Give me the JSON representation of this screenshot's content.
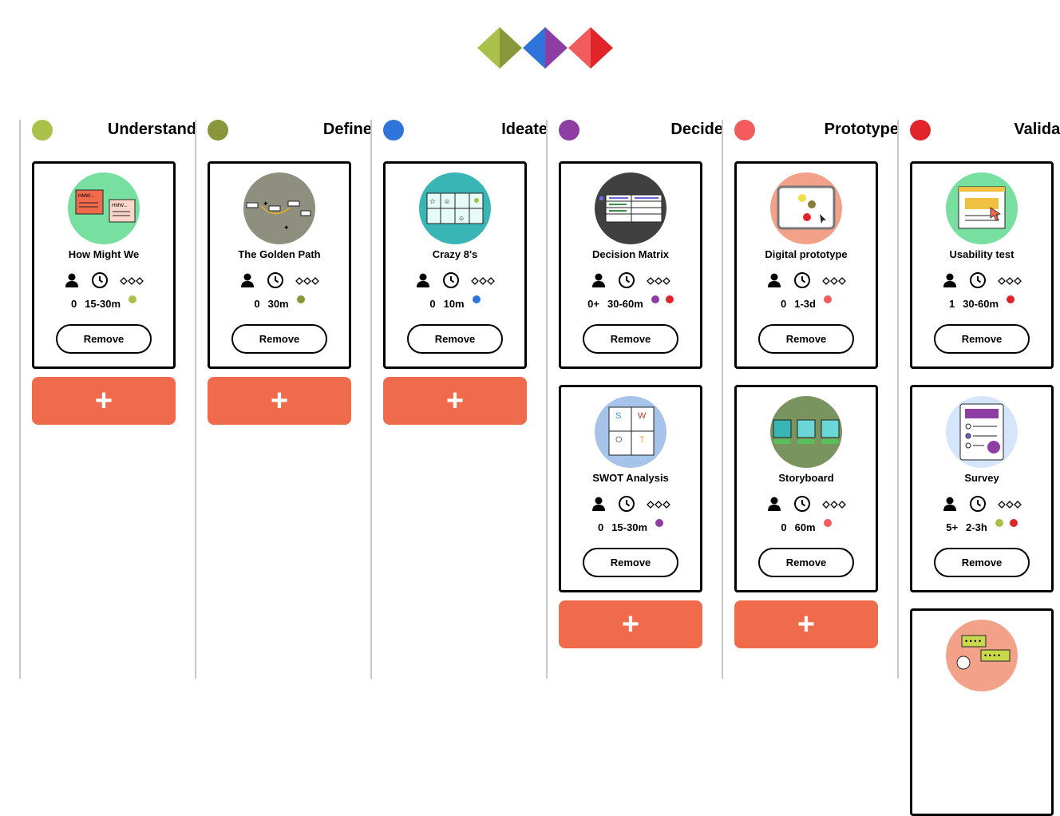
{
  "logo": {
    "name": "double-diamond-logo"
  },
  "columns": [
    {
      "title": "Understand",
      "color": "#a9c04a",
      "cards": [
        {
          "name": "How Might We",
          "people": "0",
          "time": "15-30m",
          "dots": [
            "#a9c04a"
          ],
          "remove": "Remove"
        }
      ],
      "add_label": "+"
    },
    {
      "title": "Define",
      "color": "#8a963a",
      "cards": [
        {
          "name": "The Golden Path",
          "people": "0",
          "time": "30m",
          "dots": [
            "#8a963a"
          ],
          "remove": "Remove"
        }
      ],
      "add_label": "+"
    },
    {
      "title": "Ideate",
      "color": "#2f74db",
      "cards": [
        {
          "name": "Crazy 8's",
          "people": "0",
          "time": "10m",
          "dots": [
            "#2f74db"
          ],
          "remove": "Remove"
        }
      ],
      "add_label": "+"
    },
    {
      "title": "Decide",
      "color": "#8e3ea2",
      "cards": [
        {
          "name": "Decision Matrix",
          "people": "0+",
          "time": "30-60m",
          "dots": [
            "#8e3ea2",
            "#e0242a"
          ],
          "remove": "Remove"
        },
        {
          "name": "SWOT Analysis",
          "people": "0",
          "time": "15-30m",
          "dots": [
            "#8e3ea2"
          ],
          "remove": "Remove"
        }
      ],
      "add_label": "+"
    },
    {
      "title": "Prototype",
      "color": "#f25c5c",
      "cards": [
        {
          "name": "Digital prototype",
          "people": "0",
          "time": "1-3d",
          "dots": [
            "#f25c5c"
          ],
          "remove": "Remove"
        },
        {
          "name": "Storyboard",
          "people": "0",
          "time": "60m",
          "dots": [
            "#f25c5c"
          ],
          "remove": "Remove"
        }
      ],
      "add_label": "+"
    },
    {
      "title": "Validate",
      "color": "#e0242a",
      "cards": [
        {
          "name": "Usability test",
          "people": "1",
          "time": "30-60m",
          "dots": [
            "#e0242a"
          ],
          "remove": "Remove"
        },
        {
          "name": "Survey",
          "people": "5+",
          "time": "2-3h",
          "dots": [
            "#a9c04a",
            "#e0242a"
          ],
          "remove": "Remove"
        },
        {
          "name": "",
          "people": "",
          "time": "",
          "dots": [],
          "remove": ""
        }
      ],
      "add_label": ""
    }
  ],
  "thumb_colors": {
    "How Might We": "#77e0a0",
    "The Golden Path": "#8f8f80",
    "Crazy 8's": "#3ab5b5",
    "Decision Matrix": "#404040",
    "SWOT Analysis": "#a6c3ea",
    "Digital prototype": "#f4a18a",
    "Storyboard": "#7a9460",
    "Usability test": "#77e0a0",
    "Survey": "#d6e6fa",
    "interview": "#f4a18a"
  },
  "icons": {
    "people": "person-icon",
    "time": "clock-icon",
    "phases": "diamonds-icon"
  }
}
